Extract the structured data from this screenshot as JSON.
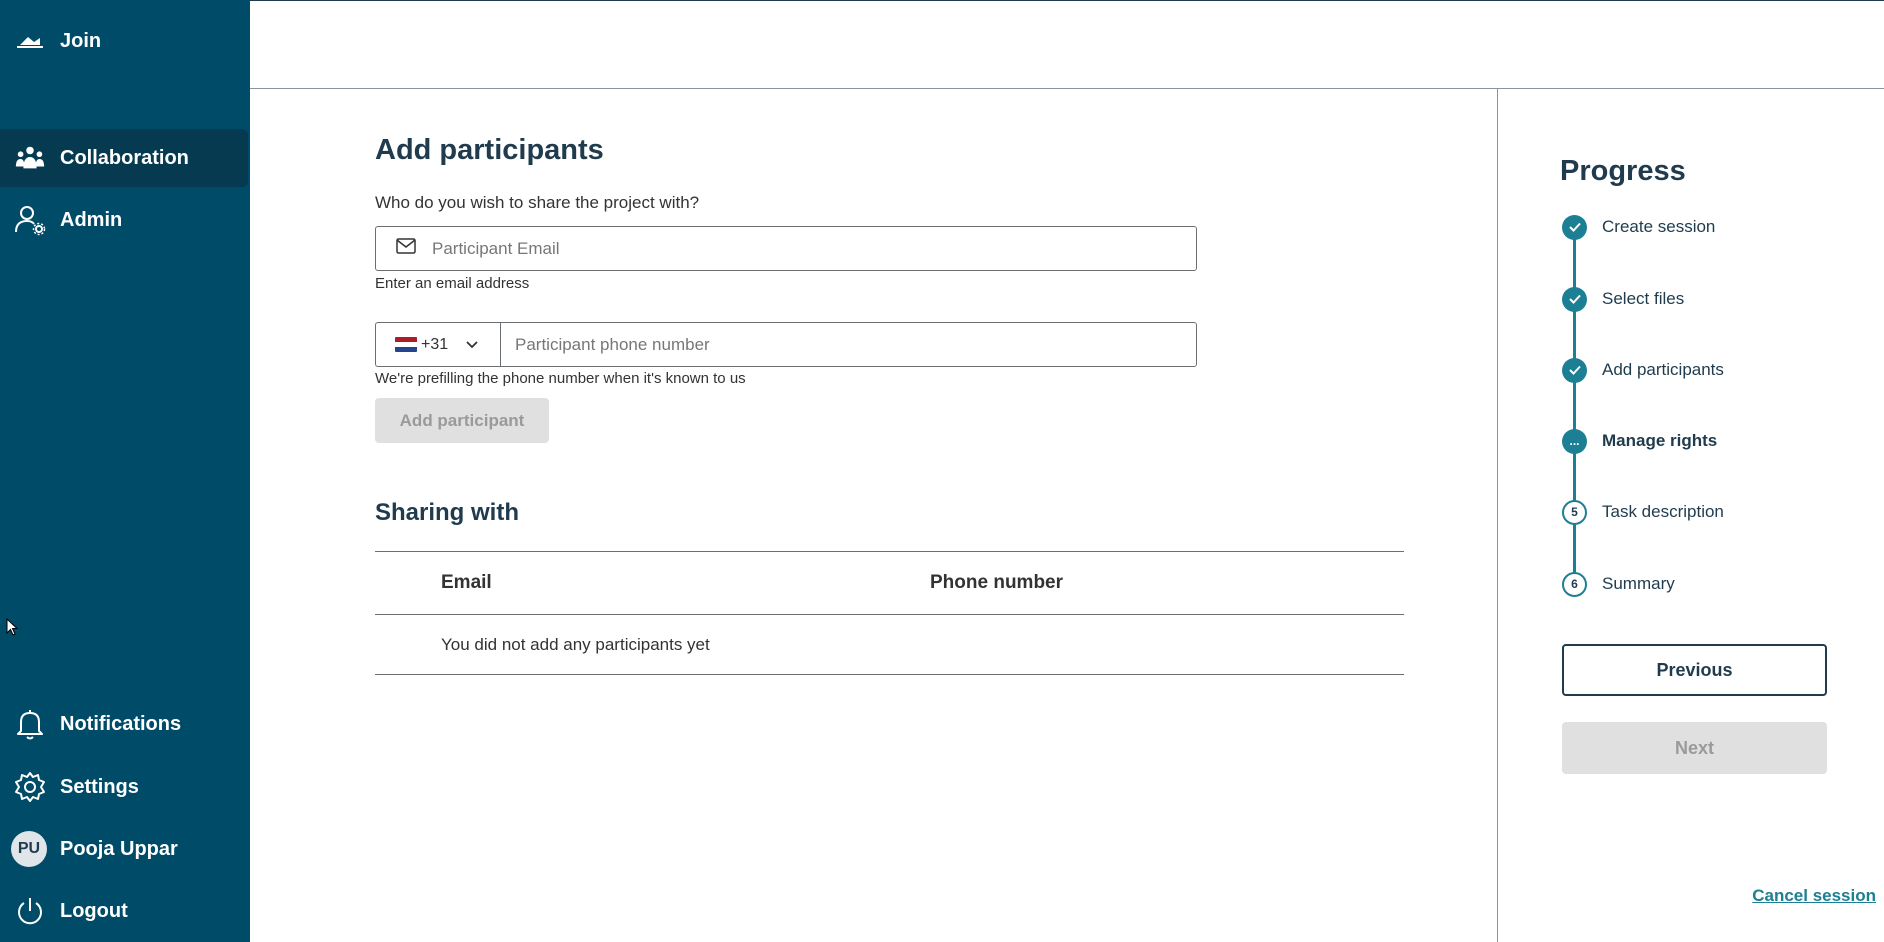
{
  "sidebar": {
    "join_label": "Join",
    "items": [
      {
        "label": "Collaboration",
        "icon": "team-icon",
        "active": true
      },
      {
        "label": "Admin",
        "icon": "user-gear-icon",
        "active": false
      }
    ],
    "bottom": {
      "notifications_label": "Notifications",
      "settings_label": "Settings",
      "user_initials": "PU",
      "user_name": "Pooja Uppar",
      "logout_label": "Logout"
    }
  },
  "form": {
    "title": "Add participants",
    "question": "Who do you wish to share the project with?",
    "email_placeholder": "Participant Email",
    "email_help": "Enter an email address",
    "country_code": "+31",
    "phone_placeholder": "Participant phone number",
    "phone_help": "We're prefilling the phone number when it's known to us",
    "add_button": "Add participant"
  },
  "sharing": {
    "title": "Sharing with",
    "columns": [
      "Email",
      "Phone number"
    ],
    "empty_text": "You did not add any participants yet"
  },
  "progress": {
    "title": "Progress",
    "steps": [
      {
        "label": "Create session",
        "status": "done",
        "marker": ""
      },
      {
        "label": "Select files",
        "status": "done",
        "marker": ""
      },
      {
        "label": "Add participants",
        "status": "done",
        "marker": ""
      },
      {
        "label": "Manage rights",
        "status": "current",
        "marker": "..."
      },
      {
        "label": "Task description",
        "status": "pending",
        "marker": "5"
      },
      {
        "label": "Summary",
        "status": "pending",
        "marker": "6"
      }
    ],
    "previous_button": "Previous",
    "next_button": "Next",
    "cancel_link": "Cancel session"
  },
  "colors": {
    "sidebar_bg": "#004b68",
    "accent": "#1d7f93",
    "heading": "#1f3b4d"
  }
}
